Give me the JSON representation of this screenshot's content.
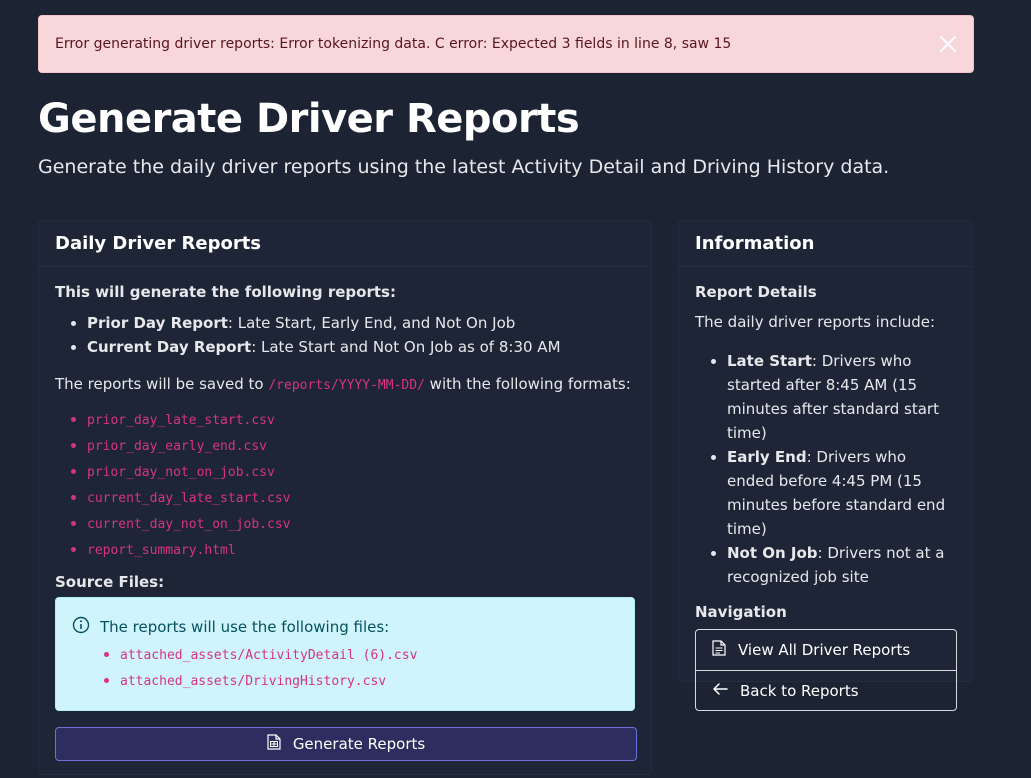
{
  "alert": {
    "message": "Error generating driver reports: Error tokenizing data. C error: Expected 3 fields in line 8, saw 15",
    "close_icon": "close-icon"
  },
  "page": {
    "title": "Generate Driver Reports",
    "subtitle": "Generate the daily driver reports using the latest Activity Detail and Driving History data."
  },
  "left_card": {
    "title": "Daily Driver Reports",
    "intro": "This will generate the following reports:",
    "reports": [
      {
        "name": "Prior Day Report",
        "desc": ": Late Start, Early End, and Not On Job"
      },
      {
        "name": "Current Day Report",
        "desc": ": Late Start and Not On Job as of 8:30 AM"
      }
    ],
    "save_prefix": "The reports will be saved to ",
    "save_path": "/reports/YYYY-MM-DD/",
    "save_suffix": " with the following formats:",
    "formats": [
      "prior_day_late_start.csv",
      "prior_day_early_end.csv",
      "prior_day_not_on_job.csv",
      "current_day_late_start.csv",
      "current_day_not_on_job.csv",
      "report_summary.html"
    ],
    "source_title": "Source Files:",
    "info_text": "The reports will use the following files:",
    "source_files": [
      "attached_assets/ActivityDetail (6).csv",
      "attached_assets/DrivingHistory.csv"
    ],
    "generate_button": "Generate Reports"
  },
  "right_card": {
    "title": "Information",
    "details_title": "Report Details",
    "details_intro": "The daily driver reports include:",
    "details": [
      {
        "name": "Late Start",
        "desc": ": Drivers who started after 8:45 AM (15 minutes after standard start time)"
      },
      {
        "name": "Early End",
        "desc": ": Drivers who ended before 4:45 PM (15 minutes before standard end time)"
      },
      {
        "name": "Not On Job",
        "desc": ": Drivers not at a recognized job site"
      }
    ],
    "nav_title": "Navigation",
    "nav_items": [
      {
        "label": "View All Driver Reports",
        "icon": "document-icon"
      },
      {
        "label": "Back to Reports",
        "icon": "arrow-left-icon"
      }
    ]
  },
  "colors": {
    "background": "#1c2333",
    "alert_bg": "#f8d7da",
    "code": "#d63384",
    "info_bg": "#cff4fc",
    "button_border": "#6b6fd6"
  }
}
